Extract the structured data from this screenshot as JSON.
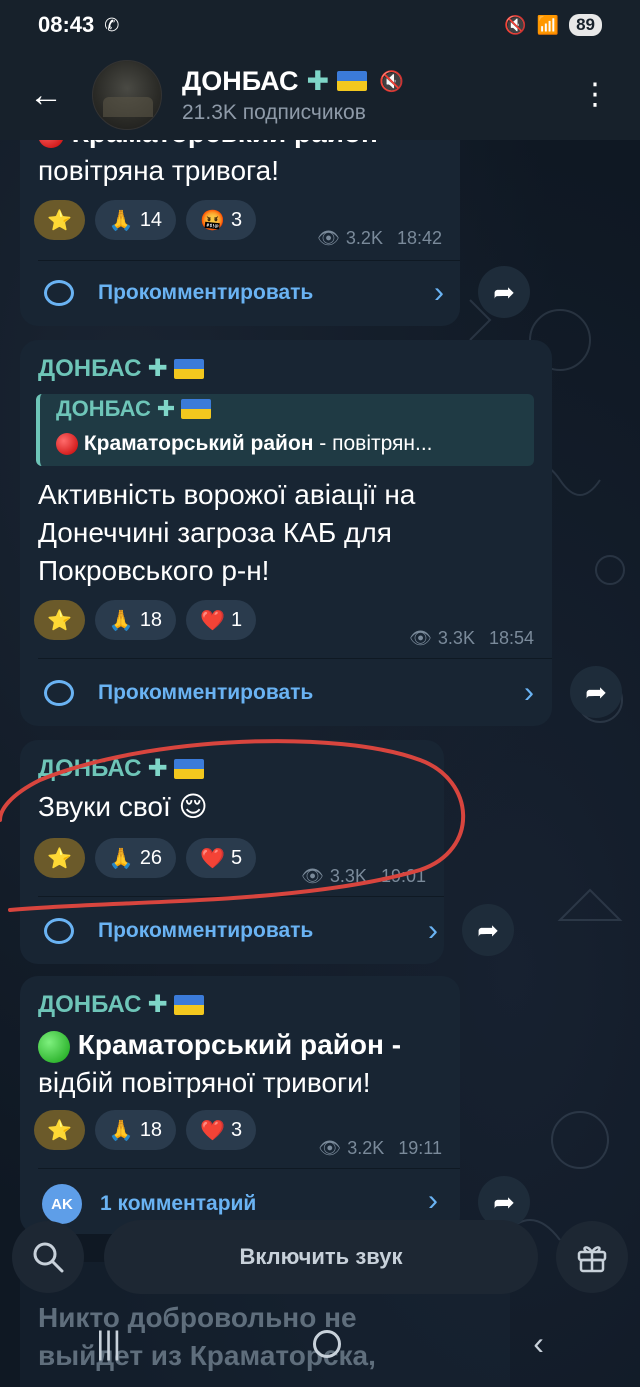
{
  "status": {
    "time": "08:43",
    "battery": "89"
  },
  "header": {
    "title": "ДОНБАС",
    "subscribers": "21.3K подписчиков"
  },
  "messages": [
    {
      "text_line1": "Краматорський район",
      "text_line2": "повітряна тривога!",
      "reactions": {
        "pray": "14",
        "angry": "3"
      },
      "views": "3.2K",
      "time": "18:42",
      "comment": "Прокомментировать"
    },
    {
      "sender": "ДОНБАС",
      "quote_title": "ДОНБАС",
      "quote_bold": "Краматорський район",
      "quote_rest": " - повітрян...",
      "text": "Активність ворожої авіації на Донеччині загроза КАБ для Покровського р-н!",
      "reactions": {
        "pray": "18",
        "heart": "1"
      },
      "views": "3.3K",
      "time": "18:54",
      "comment": "Прокомментировать"
    },
    {
      "sender": "ДОНБАС",
      "text": "Звуки свої 😌",
      "reactions": {
        "pray": "26",
        "heart": "5"
      },
      "views": "3.3K",
      "time": "19:01",
      "comment": "Прокомментировать"
    },
    {
      "sender": "ДОНБАС",
      "text_bold": "Краматорський район -",
      "text_line2": "відбій повітряної тривоги!",
      "reactions": {
        "pray": "18",
        "heart": "3"
      },
      "views": "3.2K",
      "time": "19:11",
      "comment_avatar": "AK",
      "comment": "1 комментарий"
    }
  ],
  "faded": {
    "line1": "Никто добровольно не",
    "line2": "выйдет из Краматорска,"
  },
  "bottom": {
    "sound_label": "Включить звук"
  }
}
